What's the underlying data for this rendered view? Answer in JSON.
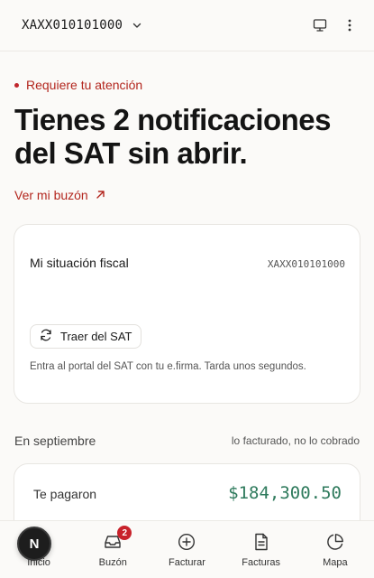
{
  "header": {
    "rfc": "XAXX010101000",
    "icons": [
      "chevron-down-icon",
      "monitor-icon",
      "more-vertical-icon"
    ]
  },
  "alert": {
    "attention_text": "Requiere tu atención",
    "headline": "Tienes 2 notificaciones del SAT sin abrir.",
    "link_text": "Ver mi buzón",
    "accent_color": "#b3261e"
  },
  "fiscal_card": {
    "title": "Mi situación fiscal",
    "rfc": "XAXX010101000",
    "sync_button": "Traer del SAT",
    "helper_text": "Entra al portal del SAT con tu e.firma. Tarda unos segundos."
  },
  "month": {
    "label": "En septiembre",
    "note": "lo facturado, no lo cobrado",
    "paid_label": "Te pagaron",
    "paid_amount": "$184,300.50",
    "amount_color": "#2e7a5c"
  },
  "avatar": {
    "initial": "N"
  },
  "nav": {
    "items": [
      {
        "label": "Inicio",
        "icon": "home-icon"
      },
      {
        "label": "Buzón",
        "icon": "inbox-icon",
        "badge": "2"
      },
      {
        "label": "Facturar",
        "icon": "plus-circle-icon"
      },
      {
        "label": "Facturas",
        "icon": "file-text-icon"
      },
      {
        "label": "Mapa",
        "icon": "pie-chart-icon"
      }
    ]
  }
}
